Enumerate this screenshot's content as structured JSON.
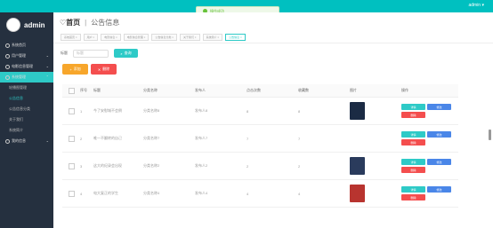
{
  "topbar": {
    "user": "admin ▾"
  },
  "toast": {
    "message": "操作成功"
  },
  "sidebar": {
    "brand": "admin",
    "items": [
      {
        "label": "系统首页"
      },
      {
        "label": "用户管理"
      },
      {
        "label": "电影信息管理"
      },
      {
        "label": "系统管理"
      }
    ],
    "subitems": [
      {
        "label": "轮播图管理"
      },
      {
        "label": "公告信息"
      },
      {
        "label": "公告信息分类"
      },
      {
        "label": "关于我们"
      },
      {
        "label": "系统简介"
      }
    ],
    "last": {
      "label": "我的信息"
    }
  },
  "header": {
    "home": "首页",
    "current": "公告信息"
  },
  "tabs": [
    {
      "label": "系统首页 ×"
    },
    {
      "label": "用户 ×"
    },
    {
      "label": "电影信息 ×"
    },
    {
      "label": "电影信息管理 ×"
    },
    {
      "label": "公告信息分类 ×"
    },
    {
      "label": "关于我们 ×"
    },
    {
      "label": "系统简介 ×"
    },
    {
      "label": "公告信息 ×"
    }
  ],
  "search": {
    "label": "标题",
    "placeholder": "标题",
    "button": "查询"
  },
  "actions": {
    "add": "添加",
    "delete": "删除"
  },
  "table": {
    "headers": [
      "序号",
      "标题",
      "分类名称",
      "发布人",
      "点击次数",
      "收藏数",
      "图片",
      "操作"
    ],
    "rows": [
      {
        "no": "1",
        "title": "今了安慰城不会倒",
        "category": "分类名称8",
        "publisher": "发布人8",
        "clicks": "8",
        "favorites": "8",
        "image": "poster-1",
        "thumb_color": "#1b2b44"
      },
      {
        "no": "2",
        "title": "唯一不翻转的自己",
        "category": "分类名称7",
        "publisher": "发布人7",
        "clicks": "7",
        "favorites": "7",
        "image": "poster-2",
        "thumb_color": "#ffffff"
      },
      {
        "no": "3",
        "title": "这大的纪录会出现",
        "category": "分类名称2",
        "publisher": "发布人2",
        "clicks": "2",
        "favorites": "2",
        "image": "poster-3",
        "thumb_color": "#2a3b5c"
      },
      {
        "no": "4",
        "title": "电大复正的学生",
        "category": "分类名称4",
        "publisher": "发布人4",
        "clicks": "4",
        "favorites": "4",
        "image": "poster-4",
        "thumb_color": "#b8342f"
      }
    ],
    "ops": {
      "detail": "详情",
      "edit": "修改",
      "delete": "删除"
    }
  }
}
